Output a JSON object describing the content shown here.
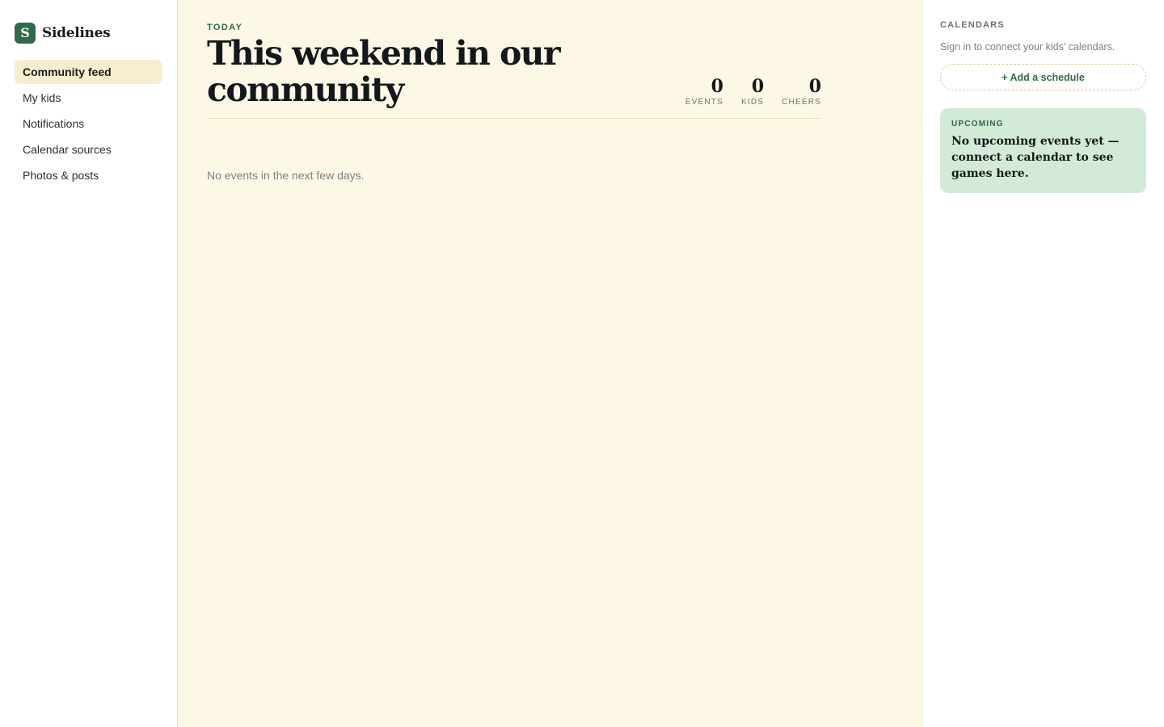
{
  "brand": {
    "logo_letter": "S",
    "name": "Sidelines",
    "accent": "#2f6b4a"
  },
  "sidebar": {
    "items": [
      {
        "label": "Community feed",
        "active": true
      },
      {
        "label": "My kids",
        "active": false
      },
      {
        "label": "Notifications",
        "active": false
      },
      {
        "label": "Calendar sources",
        "active": false
      },
      {
        "label": "Photos & posts",
        "active": false
      }
    ]
  },
  "main": {
    "eyebrow": "TODAY",
    "title": "This weekend in our community",
    "stats": [
      {
        "value": "0",
        "label": "EVENTS"
      },
      {
        "value": "0",
        "label": "KIDS"
      },
      {
        "value": "0",
        "label": "CHEERS"
      }
    ],
    "empty_message": "No events in the next few days."
  },
  "right_panel": {
    "calendars_label": "CALENDARS",
    "calendars_hint": "Sign in to connect your kids' calendars.",
    "add_schedule_label": "+ Add a schedule",
    "upcoming_label": "UPCOMING",
    "upcoming_message": "No upcoming events yet — connect a calendar to see games here."
  },
  "colors": {
    "main_background": "#fdf8e6",
    "active_nav": "#f5efcf",
    "upcoming_card": "#d4ead8"
  }
}
